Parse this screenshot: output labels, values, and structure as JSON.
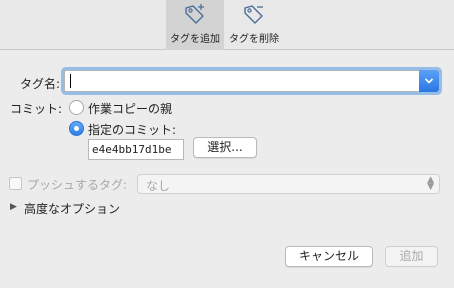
{
  "toolbar": {
    "add_tag_label": "タグを追加",
    "delete_tag_label": "タグを削除",
    "add_icon": "tag-add-icon",
    "delete_icon": "tag-remove-icon"
  },
  "form": {
    "tag_name_label": "タグ名:",
    "tag_name_value": "",
    "commit_label": "コミット:",
    "radio_working_copy_parent": "作業コピーの親",
    "radio_specified_commit": "指定のコミット:",
    "selected_radio": "specified_commit",
    "commit_hash": "e4e4bb17d1be",
    "select_button": "選択...",
    "push_tag_label": "プッシュするタグ:",
    "push_tag_checked": false,
    "push_tag_value": "なし",
    "advanced_options_label": "高度なオプション"
  },
  "actions": {
    "cancel": "キャンセル",
    "add": "追加"
  },
  "colors": {
    "accent": "#2f7fe6",
    "focus_ring": "#5096e6",
    "window_bg": "#ececec",
    "disabled_text": "#a8a8a8"
  }
}
